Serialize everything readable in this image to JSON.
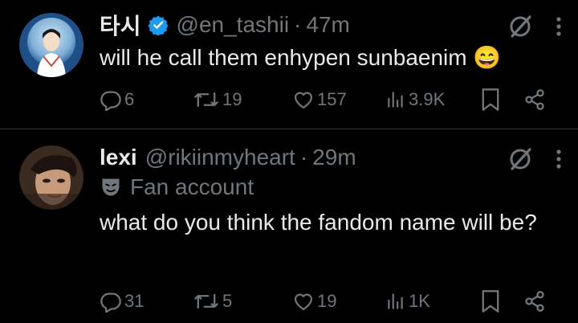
{
  "tweets": [
    {
      "name": "타시",
      "handle": "@en_tashii",
      "separator": "·",
      "time": "47m",
      "verified": true,
      "text": "will he call them enhypen sunbaenim 😄",
      "replies": "6",
      "reposts": "19",
      "likes": "157",
      "views": "3.9K"
    },
    {
      "name": "lexi",
      "handle": "@rikiinmyheart",
      "separator": "·",
      "time": "29m",
      "verified": false,
      "label": "Fan account",
      "text": "what do you think the fandom name will be?",
      "replies": "31",
      "reposts": "5",
      "likes": "19",
      "views": "1K"
    }
  ],
  "colors": {
    "background": "#000000",
    "text": "#e7e9ea",
    "muted": "#71767b",
    "verified": "#1d9bf0"
  }
}
